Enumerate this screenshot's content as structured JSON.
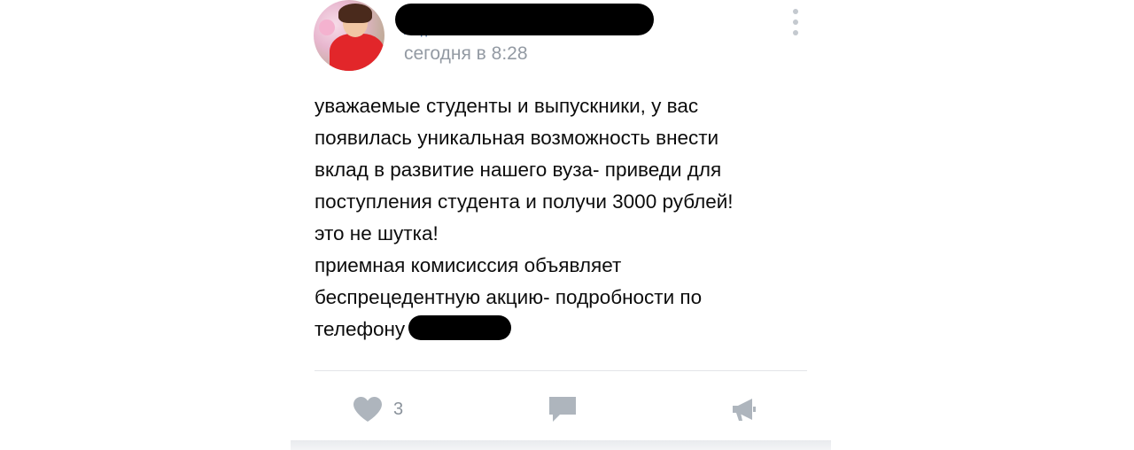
{
  "post": {
    "author_peek": "Люд",
    "timestamp": "сегодня в 8:28",
    "text_lines": [
      "уважаемые студенты и выпускники, у вас",
      "появилась уникальная возможность внести",
      "вклад в развитие нашего вуза- приведи для",
      "поступления студента и получи 3000 рублей!",
      "это не шутка!",
      "приемная комисиссия объявляет",
      "беспрецедентную акцию- подробности по",
      "телефону"
    ],
    "likes_count": "3"
  },
  "icons": {
    "like": "heart-icon",
    "comment": "comment-icon",
    "share": "megaphone-icon",
    "menu": "more-vertical-icon"
  },
  "colors": {
    "icon_gray": "#aeb5bd",
    "timestamp_gray": "#939aa3",
    "text": "#0c0c0c"
  }
}
